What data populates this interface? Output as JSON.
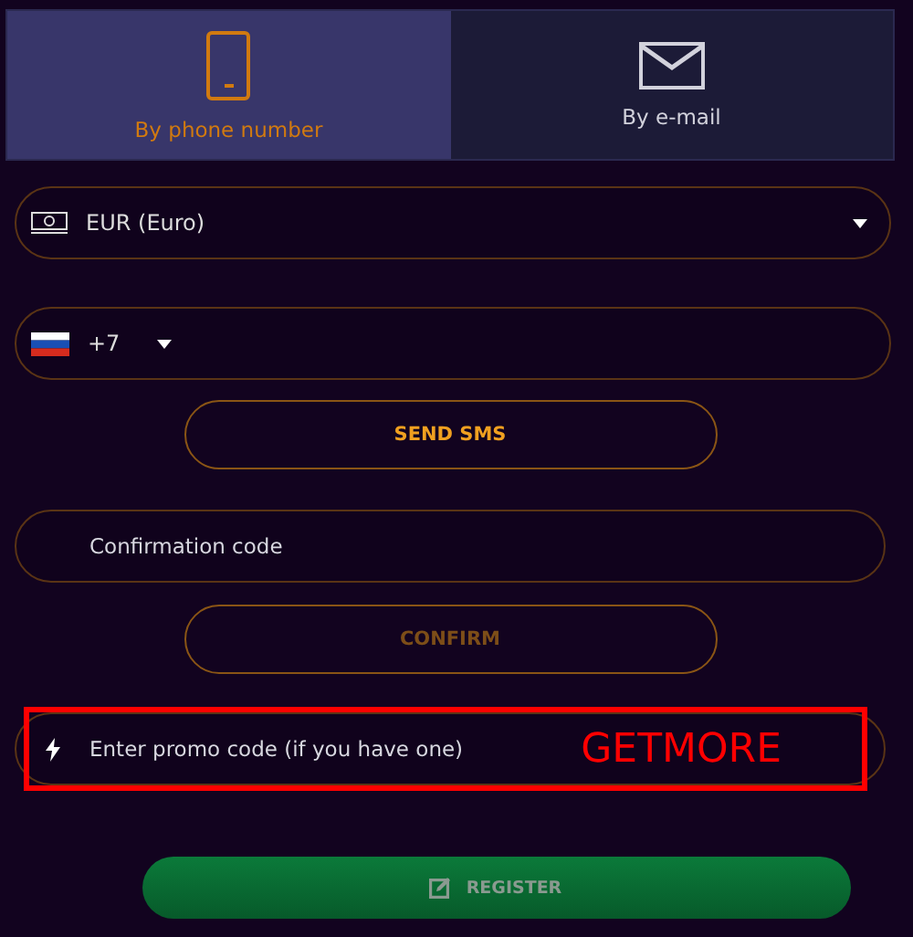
{
  "tabs": [
    {
      "label": "By phone number",
      "kind": "phone",
      "selected": true
    },
    {
      "label": "By e-mail",
      "kind": "email",
      "selected": false
    }
  ],
  "currency": {
    "value": "EUR (Euro)"
  },
  "phone": {
    "code": "+7"
  },
  "send_button": {
    "label": "SEND SMS",
    "disabled": false
  },
  "confirmation": {
    "placeholder": "Confirmation code"
  },
  "confirm_button": {
    "label": "CONFIRM",
    "disabled": true
  },
  "promo": {
    "placeholder": "Enter promo code (if you have one)"
  },
  "annotation": {
    "text": "GETMORE"
  },
  "register_button": {
    "label": "REGISTER",
    "disabled": true
  }
}
